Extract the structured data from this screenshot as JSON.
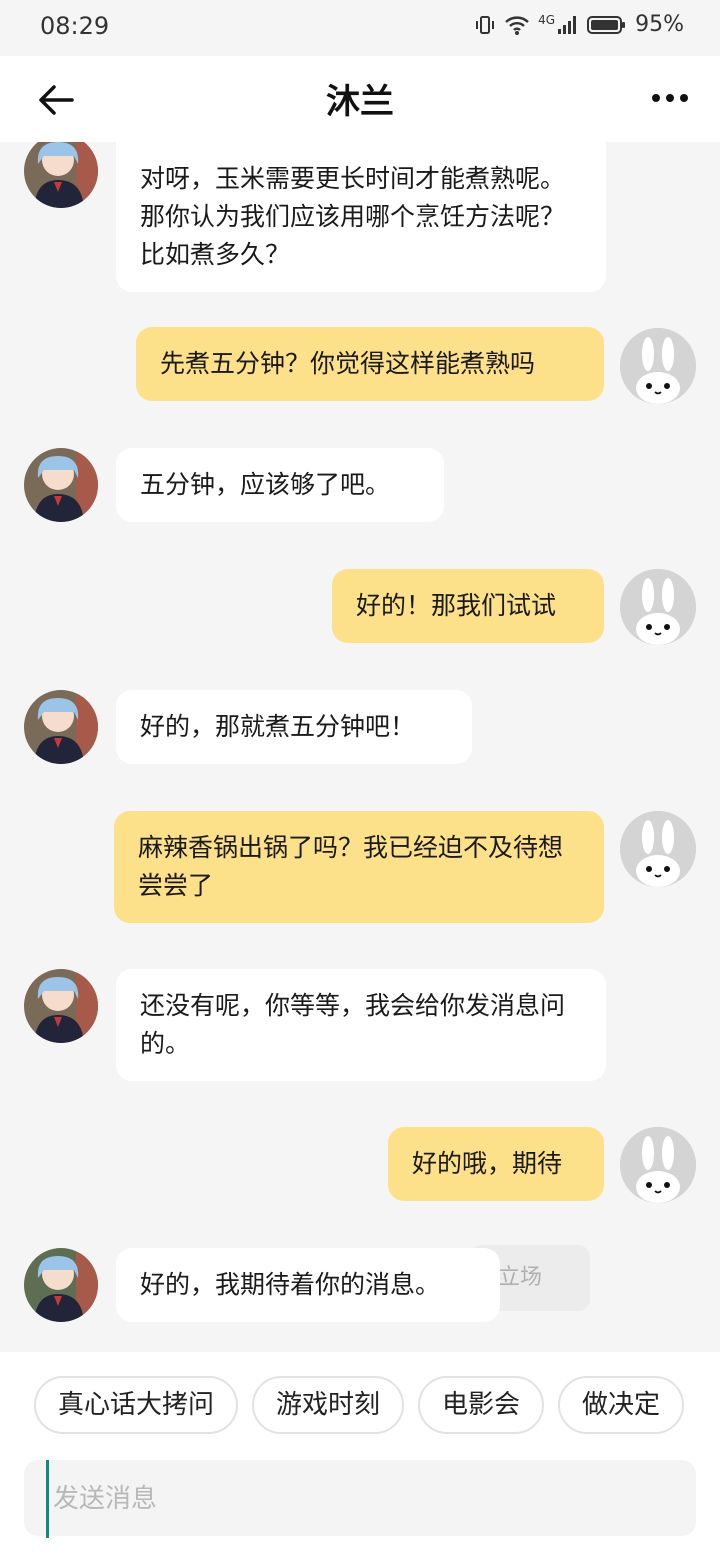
{
  "status_bar": {
    "time": "08:29",
    "network": "4G",
    "battery": "95%"
  },
  "header": {
    "title": "沐兰",
    "back_icon": "arrow-left-icon",
    "more_icon": "more-horizontal-icon"
  },
  "messages": [
    {
      "side": "left",
      "text": "对呀，玉米需要更长时间才能煮熟呢。那你认为我们应该用哪个烹饪方法呢？比如煮多久？"
    },
    {
      "side": "right",
      "text": "先煮五分钟？你觉得这样能煮熟吗"
    },
    {
      "side": "left",
      "text": "五分钟，应该够了吧。"
    },
    {
      "side": "right",
      "text": "好的！那我们试试"
    },
    {
      "side": "left",
      "text": "好的，那就煮五分钟吧！"
    },
    {
      "side": "right",
      "text": "麻辣香锅出锅了吗？我已经迫不及待想尝尝了"
    },
    {
      "side": "left",
      "text": "还没有呢，你等等，我会给你发消息问的。"
    },
    {
      "side": "right",
      "text": "好的哦，期待"
    },
    {
      "side": "left",
      "text": "好的，我期待着你的消息。"
    }
  ],
  "ghost_hint": "立场",
  "quick_chips": [
    "真心话大拷问",
    "游戏时刻",
    "电影会",
    "做决定"
  ],
  "input": {
    "placeholder": "发送消息",
    "value": ""
  },
  "colors": {
    "user_bubble": "#fde08a",
    "bot_bubble": "#ffffff",
    "background": "#f5f5f5"
  }
}
